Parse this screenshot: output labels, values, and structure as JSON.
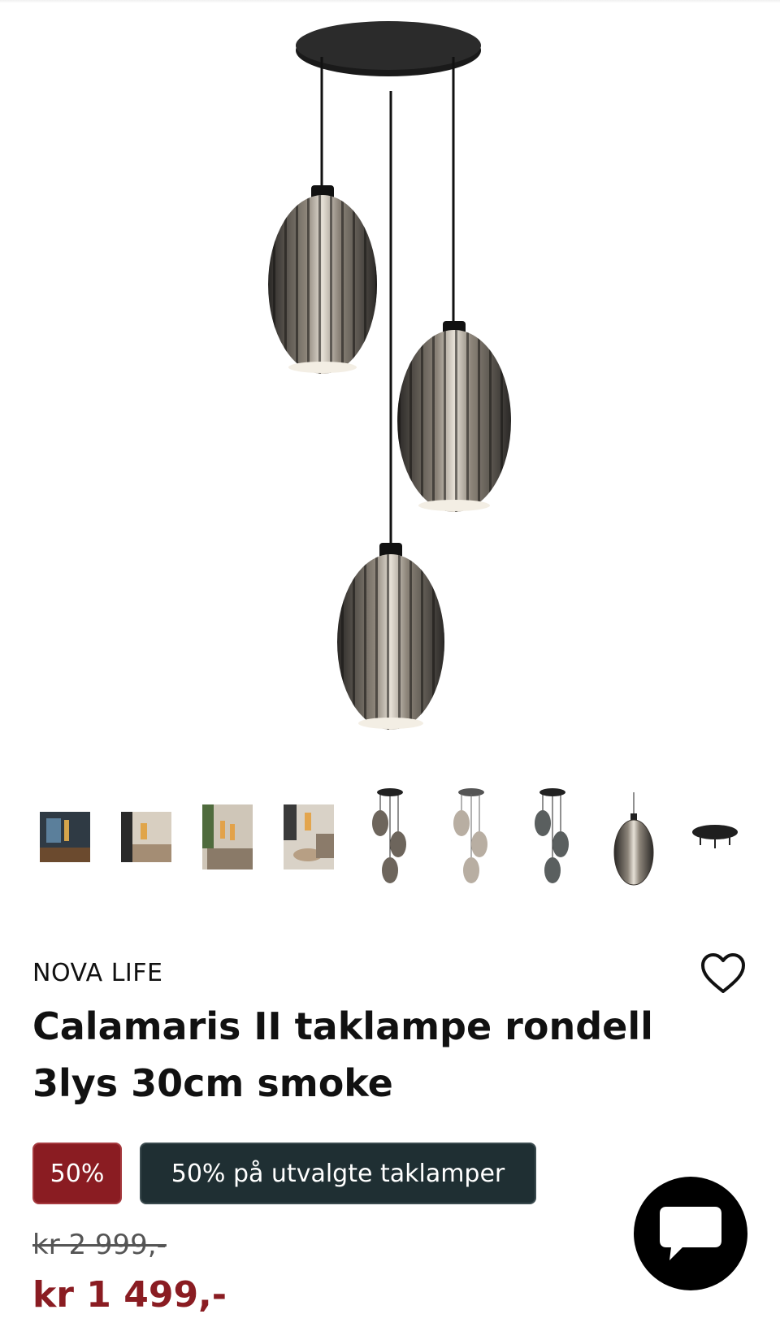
{
  "product": {
    "brand": "NOVA LIFE",
    "title": "Calamaris II taklampe rondell 3lys 30cm smoke",
    "discount_badge": "50%",
    "campaign_badge": "50% på utvalgte taklamper",
    "old_price": "kr 2 999,-",
    "price": "kr 1 499,-"
  },
  "gallery": {
    "main_image": "pendant-lamp-three-smoke-shades",
    "thumbnails": [
      "room-photo-dark",
      "room-photo-living",
      "room-photo-sofa",
      "room-photo-table",
      "lamp-smoke",
      "lamp-clear",
      "lamp-grey",
      "single-shade",
      "ceiling-plate"
    ]
  },
  "icons": {
    "wishlist": "heart-outline-icon",
    "chat": "chat-bubble-icon"
  },
  "colors": {
    "discount_bg": "#8a1c22",
    "campaign_bg": "#1f2f33",
    "price": "#8a1c22"
  }
}
